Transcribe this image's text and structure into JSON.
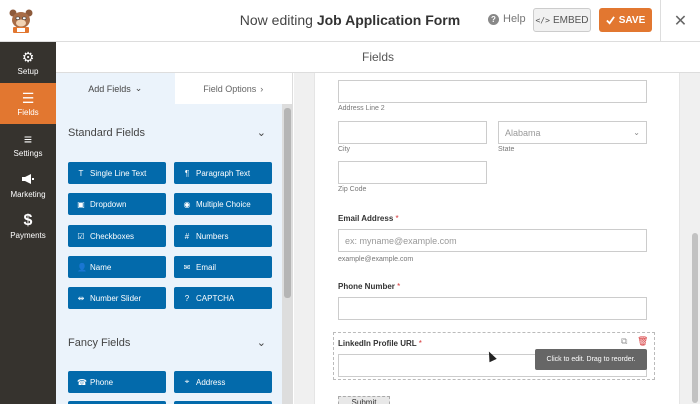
{
  "topbar": {
    "editing_prefix": "Now editing",
    "form_name": "Job Application Form",
    "help_label": "Help",
    "embed_label": "EMBED",
    "save_label": "SAVE",
    "close_glyph": "✕"
  },
  "sidebar": {
    "items": [
      {
        "label": "Setup",
        "icon": "gear-icon",
        "glyph": "⚙"
      },
      {
        "label": "Fields",
        "icon": "fields-list-icon",
        "glyph": "☰",
        "active": true
      },
      {
        "label": "Settings",
        "icon": "sliders-icon",
        "glyph": "≡"
      },
      {
        "label": "Marketing",
        "icon": "megaphone-icon",
        "glyph": "📢"
      },
      {
        "label": "Payments",
        "icon": "dollar-icon",
        "glyph": "$"
      }
    ]
  },
  "main": {
    "header_title": "Fields"
  },
  "panel": {
    "tabs": [
      {
        "label": "Add Fields",
        "chevron": "⌄"
      },
      {
        "label": "Field Options",
        "chevron": "›"
      }
    ],
    "standard_title": "Standard Fields",
    "standard_fields": [
      {
        "label": "Single Line Text",
        "glyph": "T"
      },
      {
        "label": "Paragraph Text",
        "glyph": "¶"
      },
      {
        "label": "Dropdown",
        "glyph": "▣"
      },
      {
        "label": "Multiple Choice",
        "glyph": "◉"
      },
      {
        "label": "Checkboxes",
        "glyph": "☑"
      },
      {
        "label": "Numbers",
        "glyph": "#"
      },
      {
        "label": "Name",
        "glyph": "👤"
      },
      {
        "label": "Email",
        "glyph": "✉"
      },
      {
        "label": "Number Slider",
        "glyph": "⇹"
      },
      {
        "label": "CAPTCHA",
        "glyph": "?"
      }
    ],
    "fancy_title": "Fancy Fields",
    "fancy_fields": [
      {
        "label": "Phone",
        "glyph": "☎"
      },
      {
        "label": "Address",
        "glyph": "⌖"
      }
    ],
    "group_chevron": "⌄"
  },
  "preview": {
    "address_line2_label": "Address Line 2",
    "city_label": "City",
    "state_label": "State",
    "state_value": "Alabama",
    "zip_label": "Zip Code",
    "email_label": "Email Address",
    "email_placeholder": "ex: myname@example.com",
    "email_sublabel": "example@example.com",
    "phone_label": "Phone Number",
    "linkedin_label": "LinkedIn Profile URL",
    "required_mark": "*",
    "tooltip": "Click to edit. Drag to reorder.",
    "submit_label": "Submit"
  },
  "colors": {
    "accent": "#e27730",
    "field_button": "#036aab",
    "sidebar_bg": "#36332e",
    "panel_bg": "#ebf3fb"
  }
}
